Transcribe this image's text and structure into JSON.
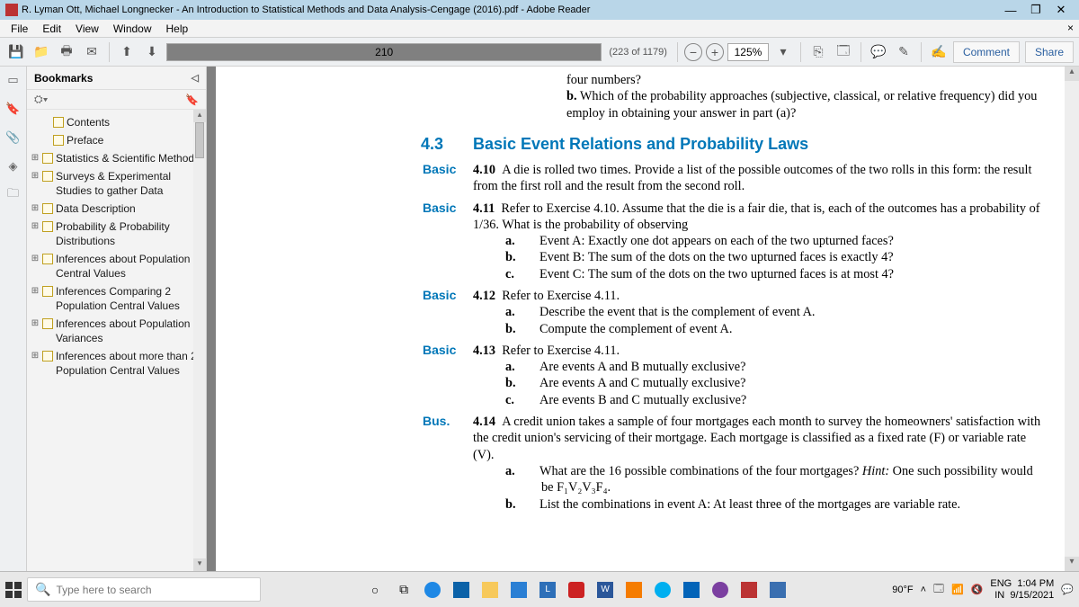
{
  "window": {
    "title": "R. Lyman Ott, Michael Longnecker - An Introduction to Statistical Methods and Data Analysis-Cengage (2016).pdf - Adobe Reader"
  },
  "menu": {
    "items": [
      "File",
      "Edit",
      "View",
      "Window",
      "Help"
    ]
  },
  "toolbar": {
    "page_value": "210",
    "page_total": "(223 of 1179)",
    "zoom_value": "125%",
    "comment": "Comment",
    "share": "Share"
  },
  "bookmarks": {
    "title": "Bookmarks",
    "items": [
      {
        "exp": "",
        "label": "Contents"
      },
      {
        "exp": "",
        "label": "Preface"
      },
      {
        "exp": "⊞",
        "label": "Statistics & Scientific Method"
      },
      {
        "exp": "⊞",
        "label": "Surveys & Experimental Studies to gather Data"
      },
      {
        "exp": "⊞",
        "label": "Data Description"
      },
      {
        "exp": "⊞",
        "label": "Probability & Probability Distributions"
      },
      {
        "exp": "⊞",
        "label": "Inferences about Population Central Values"
      },
      {
        "exp": "⊞",
        "label": "Inferences Comparing 2 Population Central Values"
      },
      {
        "exp": "⊞",
        "label": "Inferences about Population Variances"
      },
      {
        "exp": "⊞",
        "label": "Inferences about more than 2 Population Central Values"
      }
    ]
  },
  "doc": {
    "intro_tail": "four numbers?",
    "intro_b": "b.",
    "intro_q": "Which of the probability approaches (subjective, classical, or relative frequency) did you employ in obtaining your answer in part (a)?",
    "sect_num": "4.3",
    "sect_title": "Basic Event Relations and Probability Laws",
    "ex": [
      {
        "level": "Basic",
        "num": "4.10",
        "text": "A die is rolled two times. Provide a list of the possible outcomes of the two rolls in this form: the result from the first roll and the result from the second roll."
      },
      {
        "level": "Basic",
        "num": "4.11",
        "text": "Refer to Exercise 4.10. Assume that the die is a fair die, that is, each of the outcomes has a probability of 1/36. What is the probability of observing",
        "subs": [
          {
            "l": "a.",
            "t": "Event A: Exactly one dot appears on each of the two upturned faces?"
          },
          {
            "l": "b.",
            "t": "Event B: The sum of the dots on the two upturned faces is exactly 4?"
          },
          {
            "l": "c.",
            "t": "Event C: The sum of the dots on the two upturned faces is at most 4?"
          }
        ]
      },
      {
        "level": "Basic",
        "num": "4.12",
        "text": "Refer to Exercise 4.11.",
        "subs": [
          {
            "l": "a.",
            "t": "Describe the event that is the complement of event A."
          },
          {
            "l": "b.",
            "t": "Compute the complement of event A."
          }
        ]
      },
      {
        "level": "Basic",
        "num": "4.13",
        "text": "Refer to Exercise 4.11.",
        "subs": [
          {
            "l": "a.",
            "t": "Are events A and B mutually exclusive?"
          },
          {
            "l": "b.",
            "t": "Are events A and C mutually exclusive?"
          },
          {
            "l": "c.",
            "t": "Are events B and C mutually exclusive?"
          }
        ]
      },
      {
        "level": "Bus.",
        "num": "4.14",
        "text": "A credit union takes a sample of four mortgages each month to survey the homeowners' satisfaction with the credit union's servicing of their mortgage. Each mortgage is classified as a fixed rate (F) or variable rate (V).",
        "subs": [
          {
            "l": "a.",
            "t": "What are the 16 possible combinations of the four mortgages? ",
            "hint": "Hint:",
            "t2": " One such possibility would be F₁V₂V₃F₄."
          },
          {
            "l": "b.",
            "t": "List the combinations in event A: At least three of the mortgages are variable rate."
          }
        ]
      }
    ]
  },
  "taskbar": {
    "search_placeholder": "Type here to search",
    "weather": "90°F",
    "lang1": "ENG",
    "lang2": "IN",
    "time": "1:04 PM",
    "date": "9/15/2021"
  }
}
